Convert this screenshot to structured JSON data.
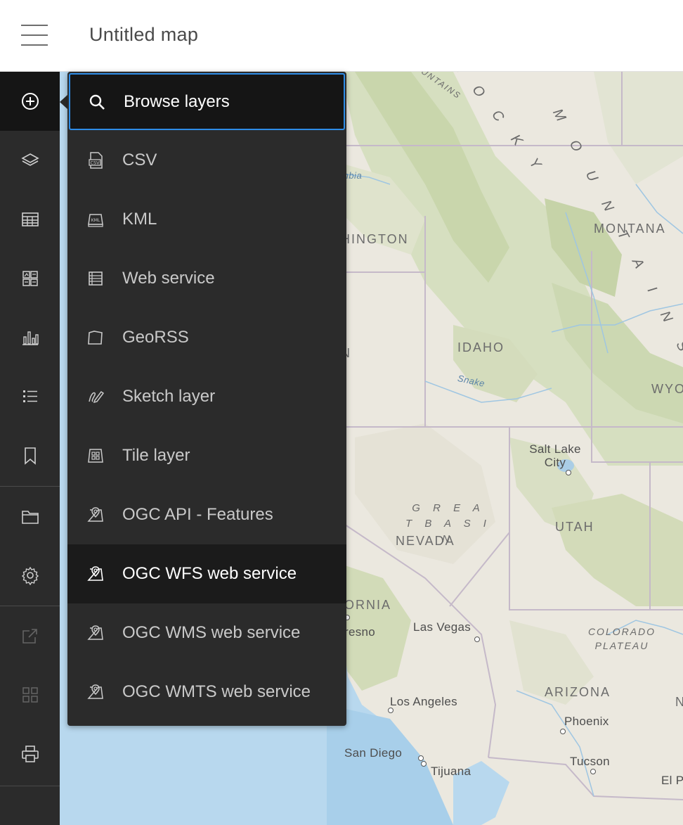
{
  "header": {
    "title": "Untitled map",
    "menu_icon": "hamburger-icon"
  },
  "toolbar": {
    "items": [
      {
        "name": "add-icon",
        "active": true
      },
      {
        "name": "layers-icon"
      },
      {
        "name": "table-icon"
      },
      {
        "name": "legend-icon"
      },
      {
        "name": "charts-icon"
      },
      {
        "name": "list-icon"
      },
      {
        "name": "bookmark-icon"
      },
      {
        "name": "folder-icon"
      },
      {
        "name": "settings-icon"
      },
      {
        "name": "share-icon",
        "disabled": true
      },
      {
        "name": "apps-icon",
        "disabled": true
      },
      {
        "name": "print-icon"
      }
    ]
  },
  "add_menu": {
    "items": [
      {
        "label": "Browse layers",
        "icon": "search-icon",
        "state": "focused"
      },
      {
        "label": "CSV",
        "icon": "csv-file-icon"
      },
      {
        "label": "KML",
        "icon": "kml-file-icon"
      },
      {
        "label": "Web service",
        "icon": "web-service-icon"
      },
      {
        "label": "GeoRSS",
        "icon": "georss-icon"
      },
      {
        "label": "Sketch layer",
        "icon": "sketch-icon"
      },
      {
        "label": "Tile layer",
        "icon": "tile-layer-icon"
      },
      {
        "label": "OGC API - Features",
        "icon": "ogc-map-icon"
      },
      {
        "label": "OGC WFS web service",
        "icon": "ogc-map-icon",
        "state": "hovered"
      },
      {
        "label": "OGC WMS web service",
        "icon": "ogc-map-icon"
      },
      {
        "label": "OGC WMTS web service",
        "icon": "ogc-map-icon"
      }
    ]
  },
  "map": {
    "labels": {
      "rocky": "R O C K Y",
      "mountains_mid": "M O U N T A I N S",
      "mtns_small": "UNTAINS",
      "washington": "HINGTON",
      "montana": "MONTANA",
      "idaho": "IDAHO",
      "oregon": "N",
      "wyoming": "WYO",
      "snake": "Snake",
      "columbia": "mbia",
      "salt_lake": "Salt Lake City",
      "great_basin": "G R E A T B A S I N",
      "nevada": "NEVADA",
      "utah": "UTAH",
      "california": "ORNIA",
      "fresno": "resno",
      "las_vegas": "Las Vegas",
      "colorado_plateau": "COLORADO PLATEAU",
      "arizona": "ARIZONA",
      "new_mexico": "N",
      "los_angeles": "Los Angeles",
      "phoenix": "Phoenix",
      "san_diego": "San Diego",
      "tijuana": "Tijuana",
      "tucson": "Tucson",
      "el_paso": "El P"
    }
  }
}
